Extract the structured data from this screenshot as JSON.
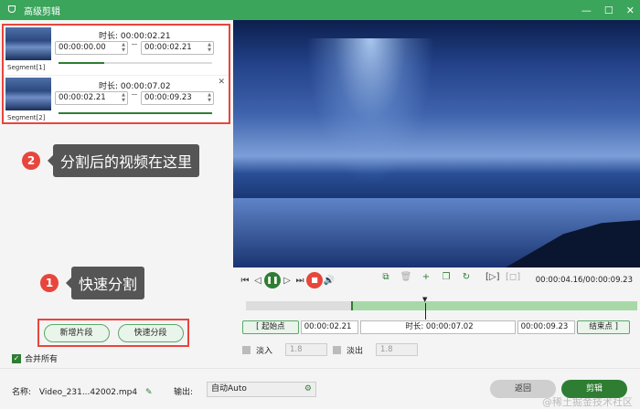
{
  "window": {
    "title": "高级剪辑",
    "minimize": "—",
    "maximize": "☐",
    "close": "✕"
  },
  "segments": [
    {
      "label": "Segment[1]",
      "duration_label": "时长: 00:00:02.21",
      "start": "00:00:00.00",
      "end": "00:00:02.21",
      "progress": 0.3
    },
    {
      "label": "Segment[2]",
      "duration_label": "时长: 00:00:07.02",
      "start": "00:00:02.21",
      "end": "00:00:09.23",
      "progress": 1.0
    }
  ],
  "callouts": [
    {
      "number": "2",
      "text": "分割后的视频在这里"
    },
    {
      "number": "1",
      "text": "快速分割"
    }
  ],
  "left_buttons": {
    "add_segment": "新增片段",
    "quick_split": "快速分段"
  },
  "merge_all": {
    "label": "合并所有",
    "checked": true
  },
  "player": {
    "timecode": "00:00:04.16/00:00:09.23"
  },
  "trim": {
    "start_button": "起始点",
    "start_value": "00:00:02.21",
    "duration_label": "时长: 00:00:07.02",
    "end_value": "00:00:09.23",
    "end_button": "结束点"
  },
  "fade": {
    "fade_in_label": "淡入",
    "fade_in_value": "1.8",
    "fade_out_label": "淡出",
    "fade_out_value": "1.8"
  },
  "footer": {
    "name_label": "名称:",
    "name_value": "Video_231...42002.mp4",
    "output_label": "输出:",
    "output_value": "自动Auto",
    "back_button": "返回",
    "cut_button": "剪辑"
  },
  "watermark": "@稀土掘金技术社区",
  "colors": {
    "accent": "#2e7d32",
    "titlebar": "#3ba55c",
    "highlight": "#e8453c"
  }
}
